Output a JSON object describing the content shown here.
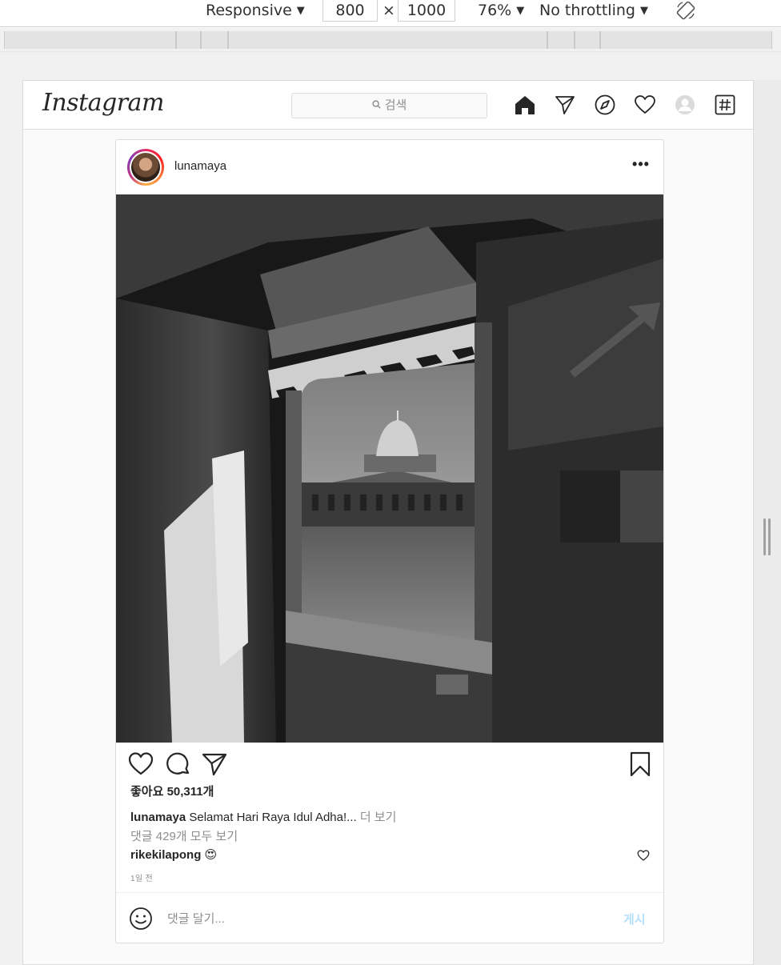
{
  "devtools": {
    "device": "Responsive",
    "width": "800",
    "times": "×",
    "height": "1000",
    "zoom": "76%",
    "throttling": "No throttling"
  },
  "header": {
    "logo": "Instagram",
    "search_placeholder": "검색"
  },
  "post": {
    "username": "lunamaya",
    "more": "•••",
    "likes": "좋아요 50,311개",
    "caption_user": "lunamaya",
    "caption_text": "Selamat Hari Raya Idul Adha!...",
    "caption_more": "더 보기",
    "view_comments": "댓글 429개 모두 보기",
    "comment_user": "rikekilapong",
    "comment_emoji": "😍",
    "timestamp": "1일 전",
    "comment_placeholder": "댓글 달기...",
    "post_button": "게시"
  },
  "colors": {
    "accent_blue_disabled": "#b2dffc",
    "text": "#262626",
    "muted": "#8e8e8e",
    "border": "#dbdbdb"
  },
  "icons": [
    "home-icon",
    "direct-icon",
    "explore-icon",
    "activity-heart-icon",
    "profile-avatar-icon",
    "hashtag-icon",
    "like-icon",
    "comment-icon",
    "share-icon",
    "save-icon",
    "emoji-icon"
  ]
}
